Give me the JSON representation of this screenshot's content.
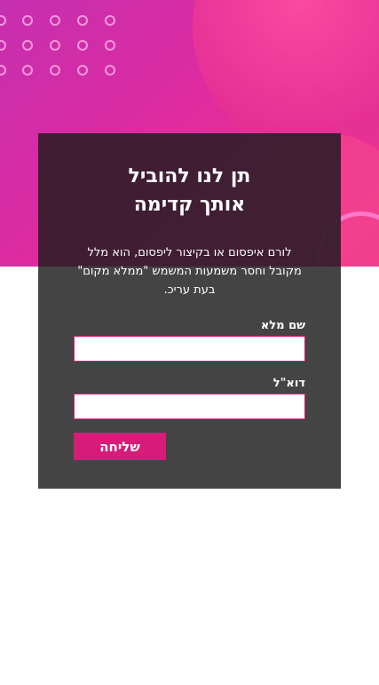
{
  "form": {
    "title_line1": "תן לנו להוביל",
    "title_line2": "אותך קדימה",
    "description": "לורם איפסום או בקיצור ליפסום, הוא מלל מקובל וחסר משמעות המשמש \"ממלא מקום\" בעת עריכ.",
    "name_label": "שם מלא",
    "name_value": "",
    "email_label": "דוא\"ל",
    "email_value": "",
    "submit_label": "שליחה"
  },
  "colors": {
    "hero_gradient_start": "#c52fb0",
    "hero_gradient_end": "#f23a8c",
    "card_background": "#444444",
    "accent": "#d51c79",
    "page_background": "#ffffff"
  }
}
